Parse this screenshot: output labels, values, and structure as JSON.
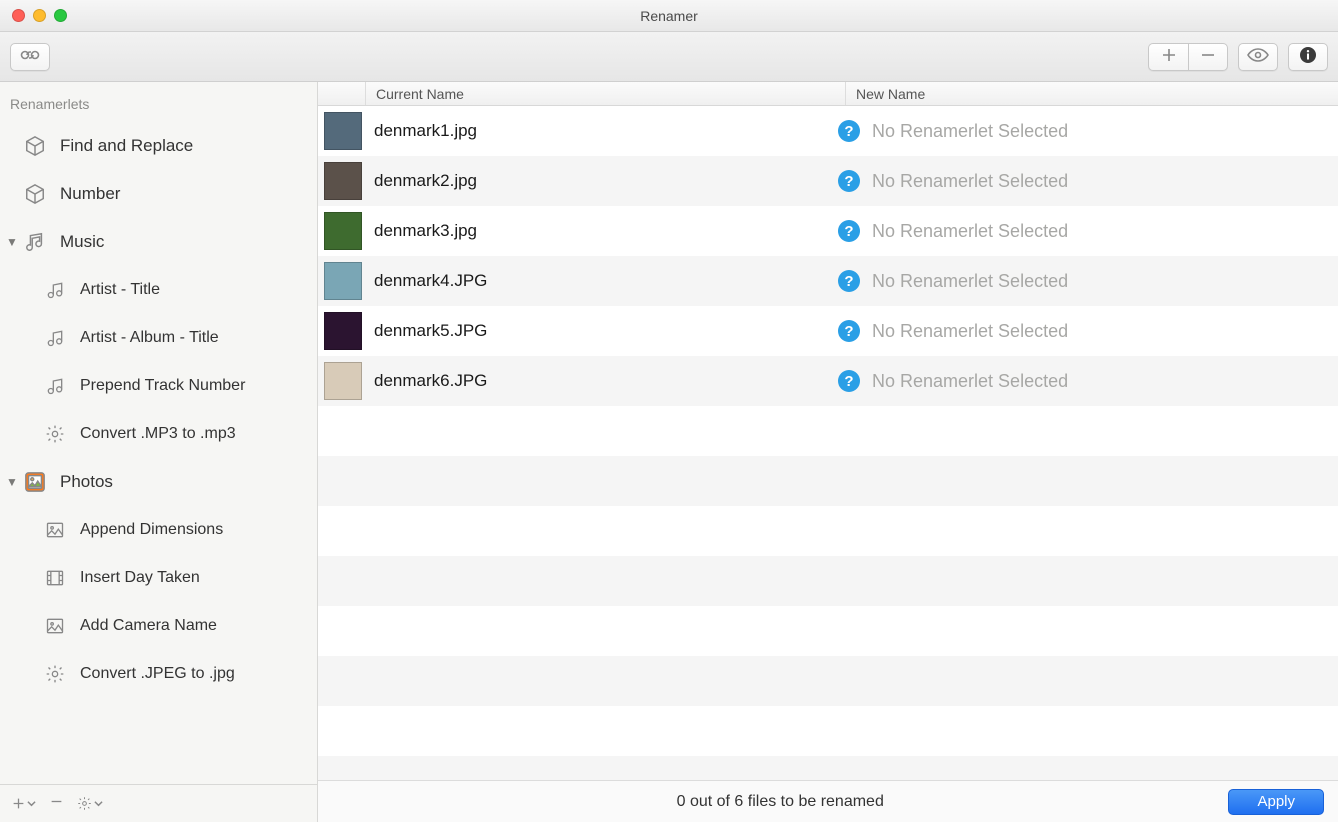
{
  "window": {
    "title": "Renamer"
  },
  "toolbar": {
    "link_icon": "link-icon",
    "add_icon": "plus-icon",
    "remove_icon": "minus-icon",
    "preview_icon": "eye-icon",
    "info_icon": "info-icon"
  },
  "sidebar": {
    "header": "Renamerlets",
    "items": [
      {
        "kind": "item",
        "icon": "cube",
        "label": "Find and Replace"
      },
      {
        "kind": "item",
        "icon": "cube",
        "label": "Number"
      },
      {
        "kind": "group",
        "icon": "music",
        "label": "Music"
      },
      {
        "kind": "child",
        "icon": "note",
        "label": "Artist - Title"
      },
      {
        "kind": "child",
        "icon": "note",
        "label": "Artist - Album - Title"
      },
      {
        "kind": "child",
        "icon": "note",
        "label": "Prepend Track Number"
      },
      {
        "kind": "child",
        "icon": "gear",
        "label": "Convert .MP3 to .mp3"
      },
      {
        "kind": "group",
        "icon": "photos",
        "label": "Photos"
      },
      {
        "kind": "child",
        "icon": "image",
        "label": "Append Dimensions"
      },
      {
        "kind": "child",
        "icon": "film",
        "label": "Insert Day Taken"
      },
      {
        "kind": "child",
        "icon": "image",
        "label": "Add Camera Name"
      },
      {
        "kind": "child",
        "icon": "gear",
        "label": "Convert .JPEG to .jpg"
      }
    ],
    "footer": {
      "add": "+",
      "remove": "−",
      "gear": "gear"
    }
  },
  "columns": {
    "current": "Current Name",
    "new": "New Name"
  },
  "files": [
    {
      "current": "denmark1.jpg",
      "new": "No Renamerlet Selected",
      "thumb": "#546a7b"
    },
    {
      "current": "denmark2.jpg",
      "new": "No Renamerlet Selected",
      "thumb": "#5b514a"
    },
    {
      "current": "denmark3.jpg",
      "new": "No Renamerlet Selected",
      "thumb": "#3e6b2f"
    },
    {
      "current": "denmark4.JPG",
      "new": "No Renamerlet Selected",
      "thumb": "#7aa6b5"
    },
    {
      "current": "denmark5.JPG",
      "new": "No Renamerlet Selected",
      "thumb": "#2b1430"
    },
    {
      "current": "denmark6.JPG",
      "new": "No Renamerlet Selected",
      "thumb": "#d8cbb8"
    }
  ],
  "empty_rows": 8,
  "status": {
    "text": "0 out of 6 files to be renamed",
    "apply": "Apply"
  }
}
